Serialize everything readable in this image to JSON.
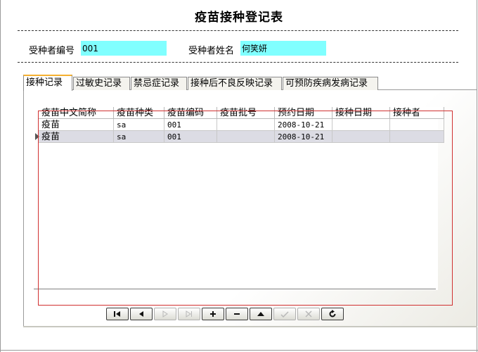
{
  "form": {
    "title": "疫苗接种登记表",
    "id_label": "受种者编号",
    "id_value": "001",
    "name_label": "受种者姓名",
    "name_value": "何笑妍"
  },
  "tabs": [
    {
      "label": "接种记录",
      "active": true
    },
    {
      "label": "过敏史记录",
      "active": false
    },
    {
      "label": "禁忌症记录",
      "active": false
    },
    {
      "label": "接种后不良反映记录",
      "active": false
    },
    {
      "label": "可预防疾病发病记录",
      "active": false
    }
  ],
  "grid": {
    "columns": [
      "疫苗中文简称",
      "疫苗种类",
      "疫苗编码",
      "疫苗批号",
      "预约日期",
      "接种日期",
      "接种者"
    ],
    "rows": [
      [
        "疫苗",
        "sa",
        "001",
        "",
        "2008-10-21",
        "",
        ""
      ],
      [
        "疫苗",
        "sa",
        "001",
        "",
        "2008-10-21",
        "",
        ""
      ]
    ],
    "selected_row": 1
  },
  "navigator": {
    "buttons": [
      {
        "name": "first-record-button",
        "icon": "first-icon",
        "enabled": true
      },
      {
        "name": "prior-record-button",
        "icon": "prior-icon",
        "enabled": true
      },
      {
        "name": "next-record-button",
        "icon": "next-icon",
        "enabled": false
      },
      {
        "name": "last-record-button",
        "icon": "last-icon",
        "enabled": false
      },
      {
        "name": "insert-record-button",
        "icon": "plus-icon",
        "enabled": true
      },
      {
        "name": "delete-record-button",
        "icon": "minus-icon",
        "enabled": true
      },
      {
        "name": "edit-record-button",
        "icon": "up-triangle-icon",
        "enabled": true
      },
      {
        "name": "post-record-button",
        "icon": "check-icon",
        "enabled": false
      },
      {
        "name": "cancel-record-button",
        "icon": "cancel-icon",
        "enabled": false
      },
      {
        "name": "refresh-record-button",
        "icon": "refresh-icon",
        "enabled": true
      }
    ]
  },
  "colors": {
    "field_bg": "#80ffff",
    "active_tab_accent": "#f5b030",
    "annotation_box": "#d03030"
  }
}
